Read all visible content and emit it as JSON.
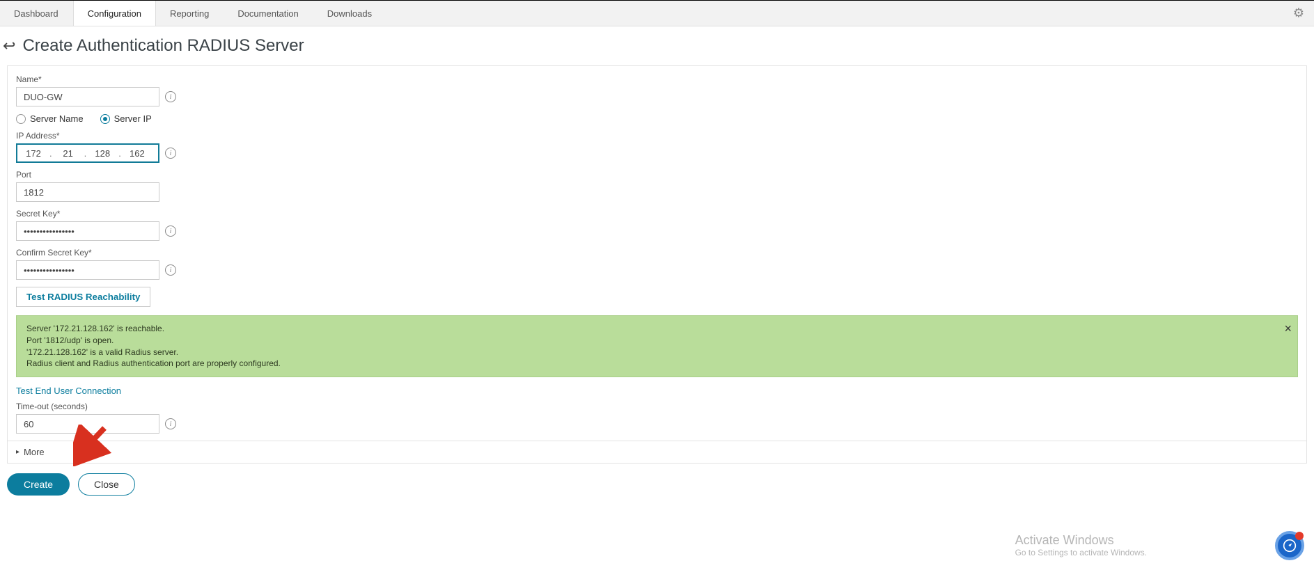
{
  "tabs": [
    "Dashboard",
    "Configuration",
    "Reporting",
    "Documentation",
    "Downloads"
  ],
  "active_tab_index": 1,
  "page_title": "Create Authentication RADIUS Server",
  "form": {
    "name_label": "Name*",
    "name_value": "DUO-GW",
    "radio_server_name": "Server Name",
    "radio_server_ip": "Server IP",
    "ip_label": "IP Address*",
    "ip_octets": [
      "172",
      "21",
      "128",
      "162"
    ],
    "port_label": "Port",
    "port_value": "1812",
    "secret_label": "Secret Key*",
    "secret_value": "••••••••••••••••",
    "confirm_secret_label": "Confirm Secret Key*",
    "confirm_secret_value": "••••••••••••••••",
    "test_button": "Test RADIUS Reachability",
    "timeout_label": "Time-out (seconds)",
    "timeout_value": "60",
    "more_label": "More"
  },
  "alert_lines": [
    "Server '172.21.128.162' is reachable.",
    "Port '1812/udp' is open.",
    "'172.21.128.162' is a valid Radius server.",
    "Radius client and Radius authentication port are properly configured."
  ],
  "link_test_enduser": "Test End User Connection",
  "buttons": {
    "create": "Create",
    "close": "Close"
  },
  "watermark": {
    "l1": "Activate Windows",
    "l2": "Go to Settings to activate Windows."
  }
}
